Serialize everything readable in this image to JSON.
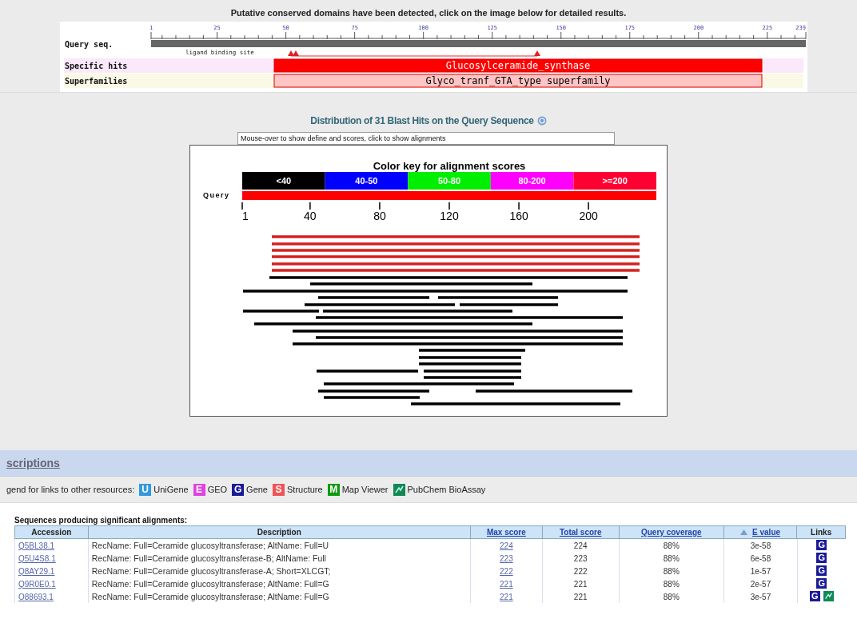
{
  "banner": "Putative conserved domains have been detected, click on the image below for detailed results.",
  "domain_graphic": {
    "query_label": "Query seq.",
    "ruler_ticks": [
      "1",
      "25",
      "50",
      "75",
      "100",
      "125",
      "150",
      "175",
      "200",
      "225",
      "239"
    ],
    "site_label": "ligand binding site",
    "tracks": [
      {
        "kind": "specific",
        "label": "Specific hits",
        "hit": "Glucosylceramide_synthase"
      },
      {
        "kind": "superfamily",
        "label": "Superfamilies",
        "hit": "Glyco_tranf_GTA_type superfamily"
      }
    ]
  },
  "blast_hits": {
    "title": "Distribution of 31 Blast Hits on the Query Sequence",
    "info_field": {
      "value": "Mouse-over to show define and scores, click to show alignments"
    },
    "key_title": "Color key for alignment scores",
    "key": [
      {
        "label": "<40",
        "color": "#000000"
      },
      {
        "label": "40-50",
        "color": "#0000ff"
      },
      {
        "label": "50-80",
        "color": "#00ee00"
      },
      {
        "label": "80-200",
        "color": "#ff00ff"
      },
      {
        "label": ">=200",
        "color": "#ff0033"
      }
    ],
    "query_label": "Query",
    "axis_ticks": [
      "1",
      "40",
      "80",
      "120",
      "160",
      "200"
    ]
  },
  "descriptions": {
    "title": "scriptions",
    "legend_text": "gend for links to other resources:",
    "resources": [
      {
        "badge": "U",
        "label": "UniGene",
        "color": "#3399dd"
      },
      {
        "badge": "E",
        "label": "GEO",
        "color": "#dd44dd"
      },
      {
        "badge": "G",
        "label": "Gene",
        "color": "#1a1a99"
      },
      {
        "badge": "S",
        "label": "Structure",
        "color": "#ee5555"
      },
      {
        "badge": "M",
        "label": "Map Viewer",
        "color": "#119911"
      },
      {
        "label": "PubChem BioAssay",
        "color": "#118855"
      }
    ]
  },
  "table": {
    "caption": "Sequences producing significant alignments:",
    "columns": [
      {
        "label": "Accession",
        "link": false,
        "sorted": false
      },
      {
        "label": "Description",
        "link": false,
        "sorted": false
      },
      {
        "label": "Max score",
        "link": true,
        "sorted": false
      },
      {
        "label": "Total score",
        "link": true,
        "sorted": false
      },
      {
        "label": "Query coverage",
        "link": true,
        "sorted": false
      },
      {
        "label": "E value",
        "link": true,
        "sorted": true
      },
      {
        "label": "Links",
        "link": false,
        "sorted": false
      }
    ],
    "rows": [
      {
        "accession": "Q5BL38.1",
        "description": "RecName: Full=Ceramide glucosyltransferase; AltName: Full=U",
        "max_score": "224",
        "total_score": "224",
        "coverage": "88%",
        "evalue": "3e-58",
        "links": [
          {
            "kind": "gene",
            "badge": "G"
          }
        ]
      },
      {
        "accession": "Q5U4S8.1",
        "description": "RecName: Full=Ceramide glucosyltransferase-B; AltName: Full",
        "max_score": "223",
        "total_score": "223",
        "coverage": "88%",
        "evalue": "6e-58",
        "links": [
          {
            "kind": "gene",
            "badge": "G"
          }
        ]
      },
      {
        "accession": "Q8AY29.1",
        "description": "RecName: Full=Ceramide glucosyltransferase-A; Short=XLCGT;",
        "max_score": "222",
        "total_score": "222",
        "coverage": "88%",
        "evalue": "1e-57",
        "links": [
          {
            "kind": "gene",
            "badge": "G"
          }
        ]
      },
      {
        "accession": "Q9R0E0.1",
        "description": "RecName: Full=Ceramide glucosyltransferase; AltName: Full=G",
        "max_score": "221",
        "total_score": "221",
        "coverage": "88%",
        "evalue": "2e-57",
        "links": [
          {
            "kind": "gene",
            "badge": "G"
          }
        ]
      },
      {
        "accession": "O88693.1",
        "description": "RecName: Full=Ceramide glucosyltransferase; AltName: Full=G",
        "max_score": "221",
        "total_score": "221",
        "coverage": "88%",
        "evalue": "3e-57",
        "links": [
          {
            "kind": "gene",
            "badge": "G"
          },
          {
            "kind": "bioassay"
          }
        ]
      }
    ]
  }
}
